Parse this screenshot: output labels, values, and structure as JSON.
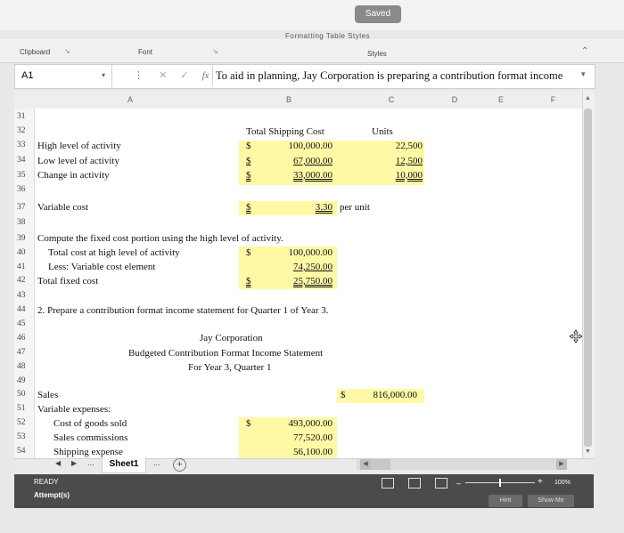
{
  "window": {
    "saved_label": "Saved"
  },
  "ribbon": {
    "top_strip": "Formatting     Table     Styles",
    "groups": [
      "Clipboard",
      "Font",
      "Styles"
    ]
  },
  "formula_bar": {
    "name_box": "A1",
    "fx": "fx",
    "formula": "To aid in planning, Jay Corporation is preparing a contribution format income"
  },
  "columns": [
    "A",
    "B",
    "C",
    "D",
    "E",
    "F"
  ],
  "rows": [
    "31",
    "32",
    "33",
    "34",
    "35",
    "36",
    "37",
    "38",
    "39",
    "40",
    "41",
    "42",
    "43",
    "44",
    "45",
    "46",
    "47",
    "48",
    "49",
    "50",
    "51",
    "52",
    "53",
    "54"
  ],
  "sheet": {
    "total_shipping_cost_hdr": "Total Shipping Cost",
    "units_hdr": "Units",
    "high_label": "High level of activity",
    "low_label": "Low level of activity",
    "change_label": "Change in activity",
    "dollar": "$",
    "high_cost": "100,000.00",
    "low_cost": "67,000.00",
    "change_cost": "33,000.00",
    "high_units": "22,500",
    "low_units": "12,500",
    "change_units": "10,000",
    "variable_cost_label": "Variable cost",
    "variable_cost_value": "3.30",
    "per_unit": "per unit",
    "compute_label": "Compute the fixed cost portion using the high level of activity.",
    "total_cost_high_label": "Total cost at high level of activity",
    "total_cost_high_value": "100,000.00",
    "less_var_label": "Less: Variable cost element",
    "less_var_value": "74,250.00",
    "total_fixed_label": "Total fixed cost",
    "total_fixed_value": "25,750.00",
    "prepare_label": "2. Prepare a contribution format income statement for Quarter 1 of Year 3.",
    "company": "Jay Corporation",
    "statement_title": "Budgeted Contribution Format Income Statement",
    "period": "For Year 3, Quarter 1",
    "sales_label": "Sales",
    "sales_value": "816,000.00",
    "var_exp_label": "Variable expenses:",
    "cogs_label": "Cost of goods sold",
    "cogs_value": "493,000.00",
    "sales_comm_label": "Sales commissions",
    "sales_comm_value": "77,520.00",
    "shipping_label": "Shipping expense",
    "shipping_value": "56,100.00"
  },
  "tabs": {
    "active": "Sheet1",
    "ellipsis": "..."
  },
  "status": {
    "ready": "READY",
    "attempts": "Attempt(s)",
    "zoom": "100%",
    "hint": "Hint",
    "show_me": "Show Me"
  }
}
